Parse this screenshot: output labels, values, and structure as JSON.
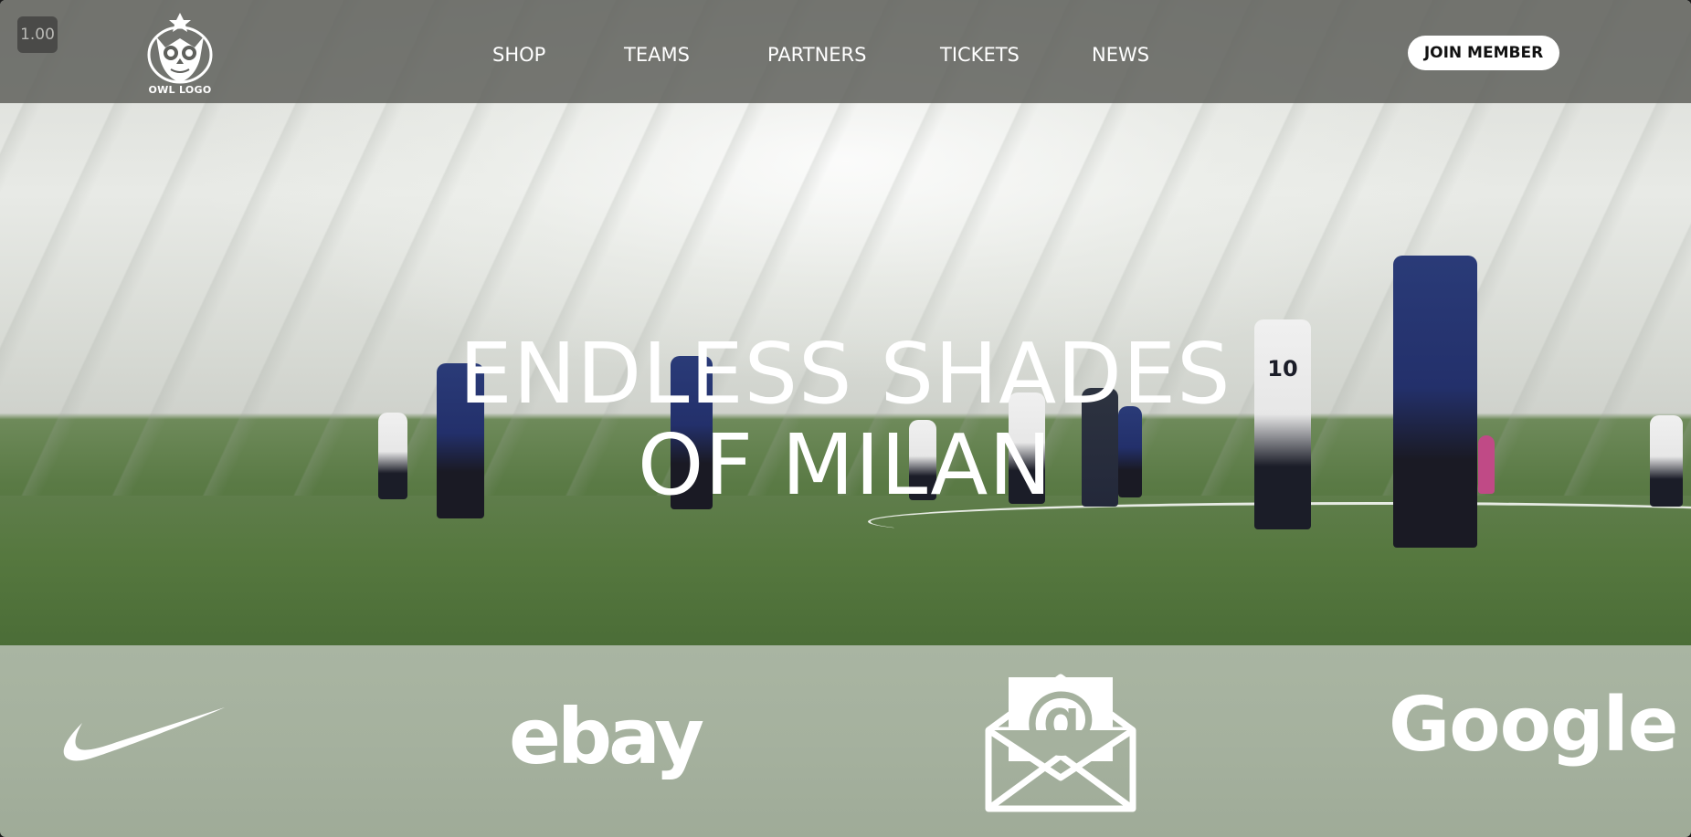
{
  "app": {
    "zoom_level": "1.00"
  },
  "header": {
    "logo_text": "OWL LOGO",
    "nav_items": [
      "SHOP",
      "TEAMS",
      "PARTNERS",
      "TICKETS",
      "NEWS"
    ],
    "join_label": "JOIN MEMBER"
  },
  "hero": {
    "headline_line1": "ENDLESS SHADES",
    "headline_line2": "OF MILAN",
    "player_shirt_number": "10"
  },
  "partners": {
    "items": [
      {
        "name": "nike",
        "icon": "nike-swoosh-icon"
      },
      {
        "name": "ebay",
        "label": "ebay"
      },
      {
        "name": "email",
        "icon": "envelope-at-icon",
        "label": "@"
      },
      {
        "name": "google",
        "label": "Google"
      }
    ]
  },
  "colors": {
    "nav_bar": "#5f605c",
    "partners_bg": "#a5b19e",
    "button_bg": "#ffffff",
    "text": "#ffffff"
  }
}
